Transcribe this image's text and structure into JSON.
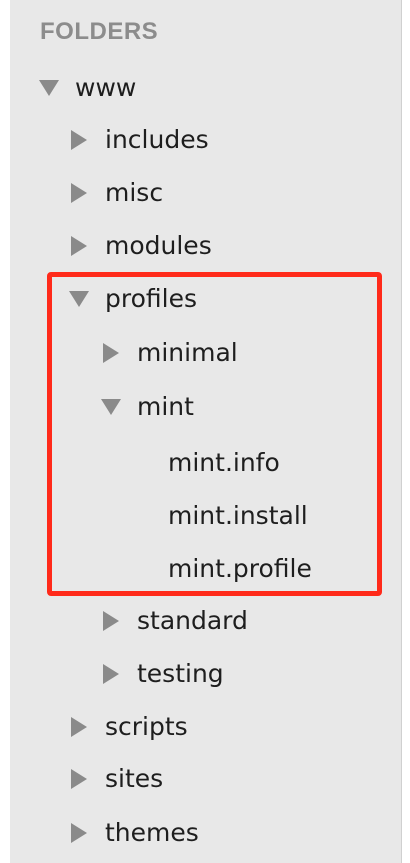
{
  "sidebar": {
    "header": "FOLDERS",
    "items": [
      {
        "label": "www",
        "state": "expanded"
      },
      {
        "label": "includes",
        "state": "collapsed"
      },
      {
        "label": "misc",
        "state": "collapsed"
      },
      {
        "label": "modules",
        "state": "collapsed"
      },
      {
        "label": "profiles",
        "state": "expanded"
      },
      {
        "label": "minimal",
        "state": "collapsed"
      },
      {
        "label": "mint",
        "state": "expanded"
      },
      {
        "label": "mint.info",
        "state": "file"
      },
      {
        "label": "mint.install",
        "state": "file"
      },
      {
        "label": "mint.profile",
        "state": "file"
      },
      {
        "label": "standard",
        "state": "collapsed"
      },
      {
        "label": "testing",
        "state": "collapsed"
      },
      {
        "label": "scripts",
        "state": "collapsed"
      },
      {
        "label": "sites",
        "state": "collapsed"
      },
      {
        "label": "themes",
        "state": "collapsed"
      }
    ]
  },
  "colors": {
    "panel_background": "#e8e8e8",
    "arrow": "#8a8a8a",
    "text": "#1e1e1e",
    "header_text": "#8c8c8c",
    "highlight_border": "#ff2a1a"
  }
}
